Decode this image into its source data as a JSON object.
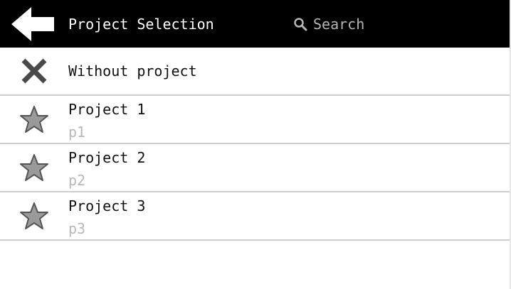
{
  "header": {
    "back_icon": "back-arrow-icon",
    "title": "Project Selection",
    "search": {
      "icon": "search-icon",
      "placeholder": "Search",
      "value": ""
    }
  },
  "colors": {
    "header_bg": "#000000",
    "header_text": "#ffffff",
    "divider": "#cfcfcf",
    "subtitle": "#b8b8b8",
    "icon_fill": "#9a9a9a"
  },
  "list": {
    "items": [
      {
        "icon": "close-icon",
        "title": "Without project",
        "subtitle": ""
      },
      {
        "icon": "star-icon",
        "title": "Project 1",
        "subtitle": "p1"
      },
      {
        "icon": "star-icon",
        "title": "Project 2",
        "subtitle": "p2"
      },
      {
        "icon": "star-icon",
        "title": "Project 3",
        "subtitle": "p3"
      }
    ]
  }
}
